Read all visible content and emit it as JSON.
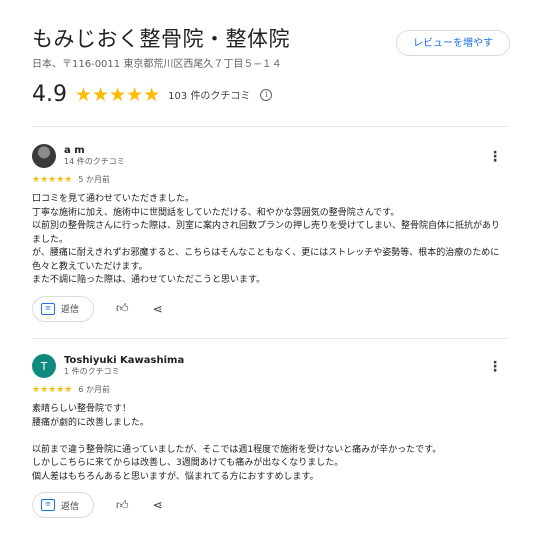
{
  "header": {
    "title": "もみじおく整骨院・整体院",
    "address": "日本、〒116-0011 東京都荒川区西尾久７丁目５−１４",
    "more_reviews_label": "レビューを増やす"
  },
  "summary": {
    "rating": "4.9",
    "stars": "★★★★★",
    "count_label": "103 件のクチコミ",
    "info_icon": "i"
  },
  "reviews": [
    {
      "name": "a m",
      "sub": "14 件のクチコミ",
      "avatar_letter": "",
      "stars": "★★★★★",
      "ago": "5 か月前",
      "body": "口コミを見て通わせていただきました。\n丁寧な施術に加え、施術中に世間話をしていただける、和やかな雰囲気の整骨院さんです。\n以前別の整骨院さんに行った際は、別室に案内され回数プランの押し売りを受けてしまい、整骨院自体に抵抗がありました。\nが、腰痛に耐えきれずお邪魔すると、こちらはそんなこともなく、更にはストレッチや姿勢等、根本的治療のために色々と教えていただけます。\nまた不調に陥った際は、通わせていただこうと思います。",
      "reply_label": "返信"
    },
    {
      "name": "Toshiyuki Kawashima",
      "sub": "1 件のクチコミ",
      "avatar_letter": "T",
      "stars": "★★★★★",
      "ago": "6 か月前",
      "body": "素晴らしい整骨院です！\n腰痛が劇的に改善しました。\n\n以前まで違う整骨院に通っていましたが、そこでは週1程度で施術を受けないと痛みが辛かったです。\nしかしこちらに来てからは改善し、3週間あけても痛みが出なくなりました。\n個人差はもちろんあると思いますが、悩まれてる方におすすめします。",
      "reply_label": "返信"
    }
  ],
  "colors": {
    "star": "#fbbc04",
    "accent": "#1a73e8",
    "avatar_t": "#0f8a7e"
  }
}
